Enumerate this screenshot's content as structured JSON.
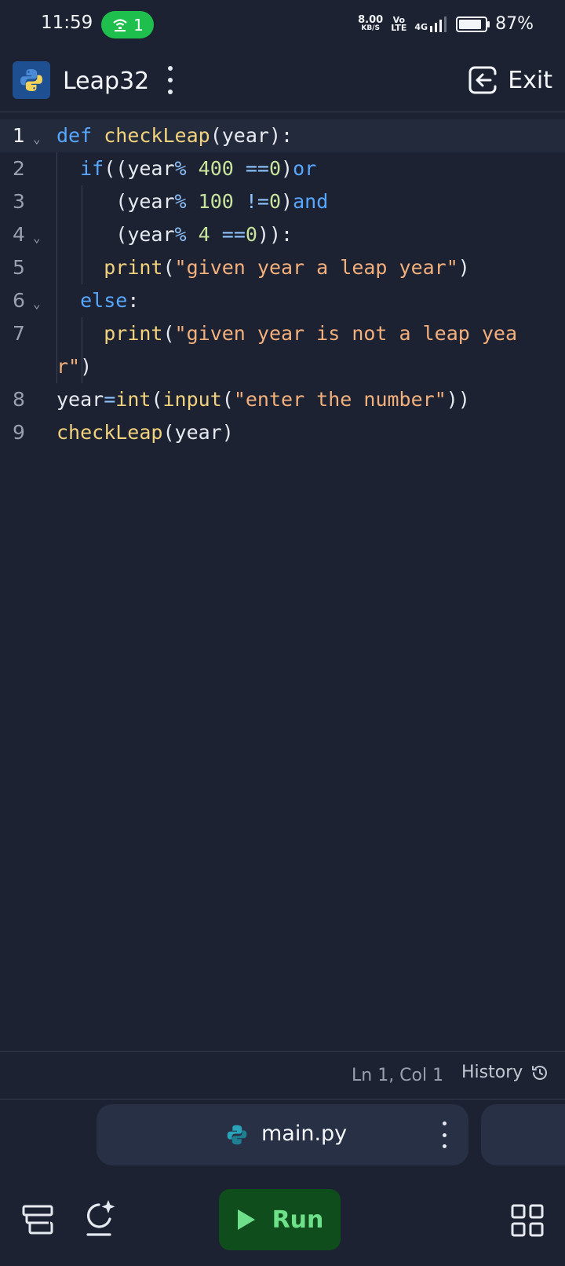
{
  "status": {
    "time": "11:59",
    "hotspot_count": "1",
    "speed": "8.00",
    "speed_unit": "KB/S",
    "volte_top": "Vo",
    "volte_bottom": "LTE",
    "network": "4G",
    "battery_level": 0.87,
    "battery": "87%"
  },
  "app": {
    "title": "Leap32",
    "exit_label": "Exit",
    "icon": "python-logo-icon"
  },
  "editor": {
    "lines": [
      {
        "n": "1",
        "fold": true,
        "active": true
      },
      {
        "n": "2"
      },
      {
        "n": "3"
      },
      {
        "n": "4",
        "fold": true
      },
      {
        "n": "5"
      },
      {
        "n": "6",
        "fold": true
      },
      {
        "n": "7"
      },
      {
        "n": "8"
      },
      {
        "n": "9"
      }
    ],
    "code": {
      "l1_kw": "def",
      "l1_fn": "checkLeap",
      "l1_rest": "(year):",
      "l2_kw": "if",
      "l2_a": "((year",
      "l2_op": "%",
      "l2_num": "400",
      "l2_eq": "==",
      "l2_zero": "0",
      "l2_close": ")",
      "l2_or": "or",
      "l3_a": "(year",
      "l3_op": "%",
      "l3_num": "100",
      "l3_ne": "!=",
      "l3_zero": "0",
      "l3_close": ")",
      "l3_and": "and",
      "l4_a": "(year",
      "l4_op": "%",
      "l4_num": "4",
      "l4_eq": "==",
      "l4_zero": "0",
      "l4_close": ")):",
      "l5_fn": "print",
      "l5_open": "(",
      "l5_str": "\"given year a leap year\"",
      "l5_close": ")",
      "l6_kw": "else",
      "l6_colon": ":",
      "l7_fn": "print",
      "l7_open": "(",
      "l7_str": "\"given year is not a leap year\"",
      "l7_close": ")",
      "l8_var": "year",
      "l8_eq": "=",
      "l8_int": "int",
      "l8_open": "(",
      "l8_input": "input",
      "l8_open2": "(",
      "l8_str": "\"enter the number\"",
      "l8_close": "))",
      "l9_fn": "checkLeap",
      "l9_rest": "(year)"
    }
  },
  "statusline": {
    "position": "Ln 1, Col 1",
    "history_label": "History"
  },
  "tabs": {
    "active_file": "main.py"
  },
  "bottom": {
    "run_label": "Run"
  }
}
